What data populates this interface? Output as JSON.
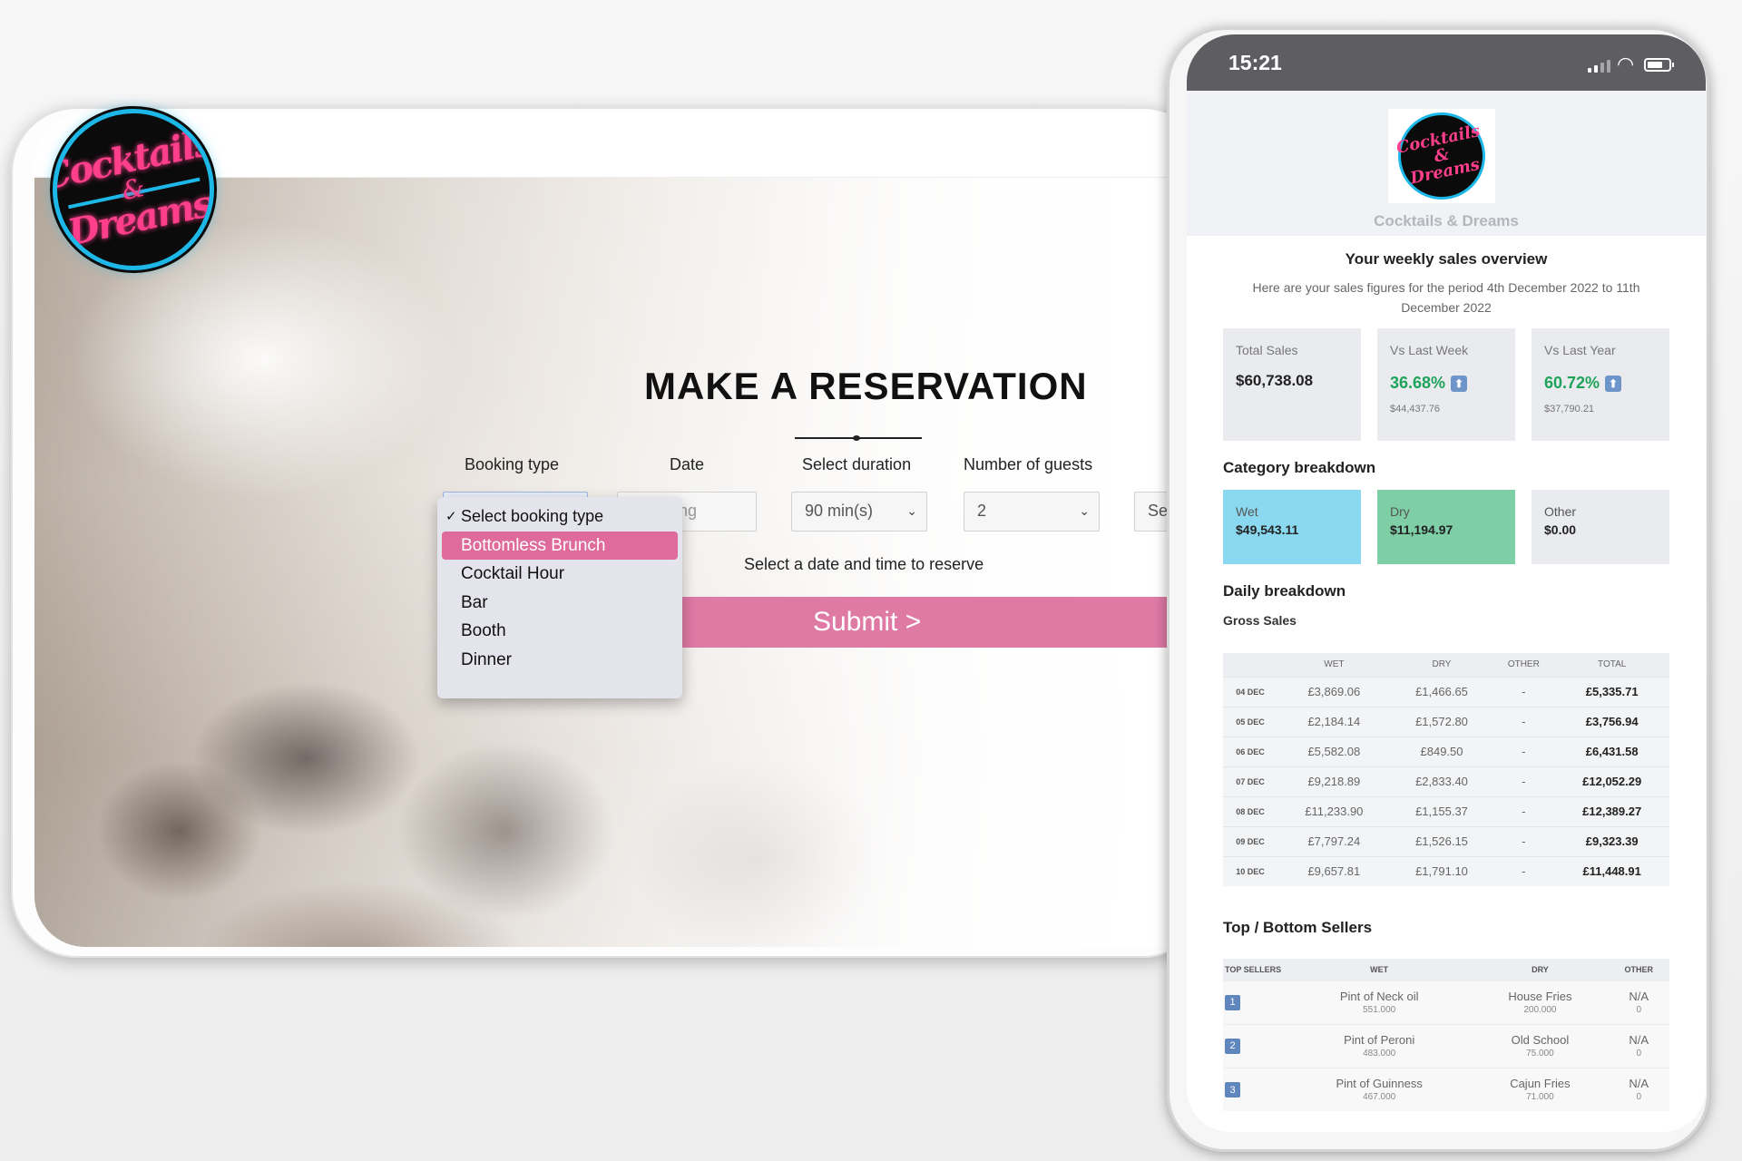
{
  "brand": {
    "logo_line1": "Cocktails",
    "logo_line2": "&",
    "logo_line3": "Dreams"
  },
  "reservation": {
    "title": "MAKE A RESERVATION",
    "labels": {
      "booking_type": "Booking type",
      "date": "Date",
      "duration": "Select duration",
      "guests": "Number of guests"
    },
    "date_placeholder": "f booking",
    "duration_value": "90 min(s)",
    "guests_value": "2",
    "time_placeholder": "Selec",
    "dropdown": {
      "selected": "Select booking type",
      "options": [
        "Bottomless Brunch",
        "Cocktail Hour",
        "Bar",
        "Booth",
        "Dinner"
      ],
      "highlighted": "Bottomless Brunch"
    },
    "hint": "Select a date and time to reserve",
    "submit_label": "Submit >",
    "accent_color": "#df7aa5"
  },
  "phone": {
    "status": {
      "time": "15:21"
    },
    "brand_name": "Cocktails & Dreams",
    "heading": "Your weekly sales overview",
    "period": "Here are your sales figures for the period 4th December 2022 to 11th December 2022",
    "stats": {
      "total": {
        "label": "Total Sales",
        "value": "$60,738.08"
      },
      "last_week": {
        "label": "Vs Last Week",
        "value": "36.68%",
        "sub": "$44,437.76"
      },
      "last_year": {
        "label": "Vs Last Year",
        "value": "60.72%",
        "sub": "$37,790.21"
      }
    },
    "category": {
      "heading": "Category breakdown",
      "wet": {
        "label": "Wet",
        "value": "$49,543.11"
      },
      "dry": {
        "label": "Dry",
        "value": "$11,194.97"
      },
      "other": {
        "label": "Other",
        "value": "$0.00"
      }
    },
    "daily": {
      "heading": "Daily breakdown",
      "subheading": "Gross Sales",
      "headers": [
        "",
        "WET",
        "DRY",
        "OTHER",
        "TOTAL"
      ],
      "rows": [
        [
          "04 DEC",
          "£3,869.06",
          "£1,466.65",
          "-",
          "£5,335.71"
        ],
        [
          "05 DEC",
          "£2,184.14",
          "£1,572.80",
          "-",
          "£3,756.94"
        ],
        [
          "06 DEC",
          "£5,582.08",
          "£849.50",
          "-",
          "£6,431.58"
        ],
        [
          "07 DEC",
          "£9,218.89",
          "£2,833.40",
          "-",
          "£12,052.29"
        ],
        [
          "08 DEC",
          "£11,233.90",
          "£1,155.37",
          "-",
          "£12,389.27"
        ],
        [
          "09 DEC",
          "£7,797.24",
          "£1,526.15",
          "-",
          "£9,323.39"
        ],
        [
          "10 DEC",
          "£9,657.81",
          "£1,791.10",
          "-",
          "£11,448.91"
        ]
      ]
    },
    "sellers": {
      "heading": "Top / Bottom Sellers",
      "headers": [
        "TOP SELLERS",
        "WET",
        "DRY",
        "OTHER"
      ],
      "rows": [
        {
          "rank": "1",
          "wet": "Pint of Neck oil",
          "wet_qty": "551.000",
          "dry": "House Fries",
          "dry_qty": "200.000",
          "other": "N/A",
          "other_qty": "0"
        },
        {
          "rank": "2",
          "wet": "Pint of Peroni",
          "wet_qty": "483.000",
          "dry": "Old School",
          "dry_qty": "75.000",
          "other": "N/A",
          "other_qty": "0"
        },
        {
          "rank": "3",
          "wet": "Pint of Guinness",
          "wet_qty": "467.000",
          "dry": "Cajun Fries",
          "dry_qty": "71.000",
          "other": "N/A",
          "other_qty": "0"
        }
      ]
    },
    "colors": {
      "wet": "#8bd9f0",
      "dry": "#7ecfa5",
      "positive": "#1fa35a"
    }
  }
}
